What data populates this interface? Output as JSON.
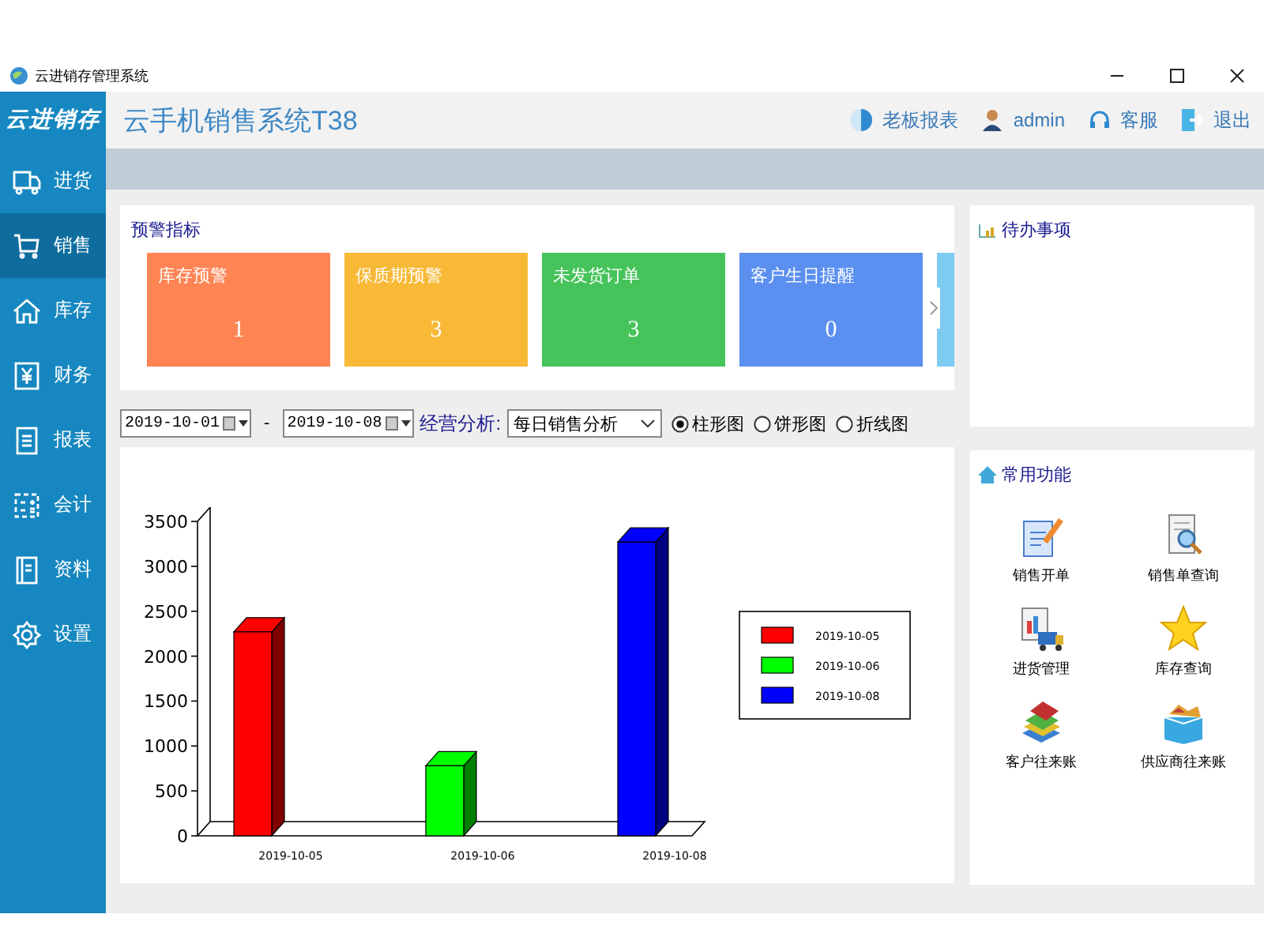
{
  "window": {
    "title": "云进销存管理系统"
  },
  "sidebar": {
    "brand": "云进销存",
    "items": [
      {
        "label": "进货",
        "kind": "truck",
        "selected": false
      },
      {
        "label": "销售",
        "kind": "cart",
        "selected": true
      },
      {
        "label": "库存",
        "kind": "house",
        "selected": false
      },
      {
        "label": "财务",
        "kind": "yen",
        "selected": false
      },
      {
        "label": "报表",
        "kind": "list",
        "selected": false
      },
      {
        "label": "会计",
        "kind": "calc",
        "selected": false
      },
      {
        "label": "资料",
        "kind": "book",
        "selected": false
      },
      {
        "label": "设置",
        "kind": "gear",
        "selected": false
      }
    ]
  },
  "header": {
    "title": "云手机销售系统T38",
    "links": [
      {
        "label": "老板报表",
        "kind": "report"
      },
      {
        "label": "admin",
        "kind": "user"
      },
      {
        "label": "客服",
        "kind": "support"
      },
      {
        "label": "退出",
        "kind": "exit"
      }
    ]
  },
  "warnings": {
    "title": "预警指标",
    "cards": [
      {
        "label": "库存预警",
        "count": "1",
        "color": "#ff8454"
      },
      {
        "label": "保质期预警",
        "count": "3",
        "color": "#f7b936"
      },
      {
        "label": "未发货订单",
        "count": "3",
        "color": "#46c35a"
      },
      {
        "label": "客户生日提醒",
        "count": "0",
        "color": "#5b8ff0"
      },
      {
        "color": "#7ecbf2"
      }
    ]
  },
  "filter": {
    "date_from": "2019-10-01",
    "separator": "-",
    "date_to": "2019-10-08",
    "analysis_label": "经营分析:",
    "analysis_value": "每日销售分析",
    "chart_types": [
      {
        "label": "柱形图",
        "selected": true
      },
      {
        "label": "饼形图",
        "selected": false
      },
      {
        "label": "折线图",
        "selected": false
      }
    ]
  },
  "chart": {
    "chart_data": {
      "type": "bar",
      "legend": true,
      "categories": [
        "2019-10-05",
        "2019-10-06",
        "2019-10-08"
      ],
      "ylim": [
        0,
        3500
      ],
      "yticks": [
        0,
        500,
        1000,
        1500,
        2000,
        2500,
        3000,
        3500
      ],
      "series": [
        {
          "name": "2019-10-05",
          "color": "#ff0000",
          "values": [
            2270,
            null,
            null
          ]
        },
        {
          "name": "2019-10-06",
          "color": "#00ff00",
          "values": [
            null,
            780,
            null
          ]
        },
        {
          "name": "2019-10-08",
          "color": "#0000ff",
          "values": [
            null,
            null,
            3270
          ]
        }
      ]
    }
  },
  "todo": {
    "title": "待办事项"
  },
  "shortcuts": {
    "title": "常用功能",
    "items": [
      {
        "label": "销售开单",
        "kind": "order"
      },
      {
        "label": "销售单查询",
        "kind": "query"
      },
      {
        "label": "进货管理",
        "kind": "purchase"
      },
      {
        "label": "库存查询",
        "kind": "star"
      },
      {
        "label": "客户往来账",
        "kind": "books"
      },
      {
        "label": "供应商往来账",
        "kind": "box"
      }
    ]
  }
}
